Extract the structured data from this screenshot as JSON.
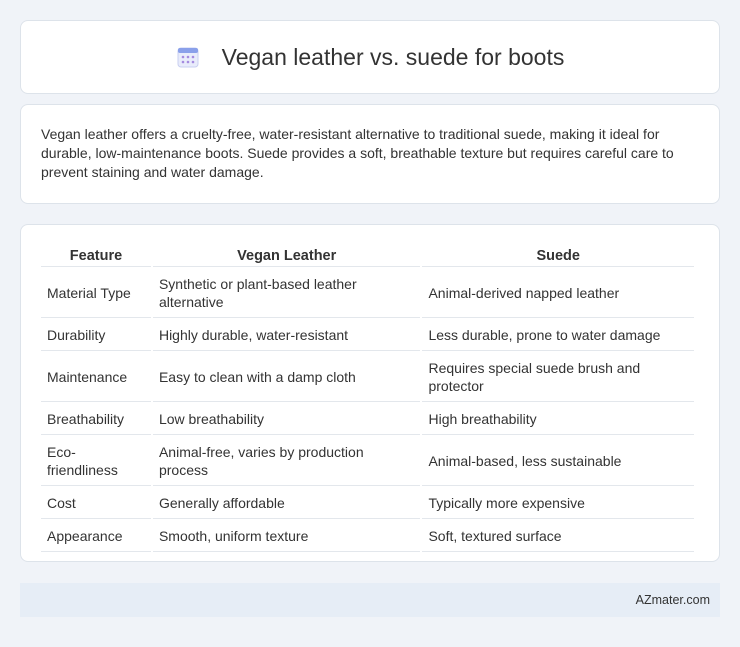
{
  "header": {
    "icon": "calendar-icon",
    "title": "Vegan leather vs. suede for boots"
  },
  "summary": {
    "text": "Vegan leather offers a cruelty-free, water-resistant alternative to traditional suede, making it ideal for durable, low-maintenance boots. Suede provides a soft, breathable texture but requires careful care to prevent staining and water damage."
  },
  "table": {
    "headers": [
      "Feature",
      "Vegan Leather",
      "Suede"
    ],
    "rows": [
      [
        "Material Type",
        "Synthetic or plant-based leather alternative",
        "Animal-derived napped leather"
      ],
      [
        "Durability",
        "Highly durable, water-resistant",
        "Less durable, prone to water damage"
      ],
      [
        "Maintenance",
        "Easy to clean with a damp cloth",
        "Requires special suede brush and protector"
      ],
      [
        "Breathability",
        "Low breathability",
        "High breathability"
      ],
      [
        "Eco-friendliness",
        "Animal-free, varies by production process",
        "Animal-based, less sustainable"
      ],
      [
        "Cost",
        "Generally affordable",
        "Typically more expensive"
      ],
      [
        "Appearance",
        "Smooth, uniform texture",
        "Soft, textured surface"
      ]
    ]
  },
  "footer": {
    "text": "AZmater.com"
  },
  "colors": {
    "background": "#f0f3f8",
    "card": "#ffffff",
    "footer_bg": "#e6edf6",
    "icon_accent": "#7b8fe0"
  }
}
